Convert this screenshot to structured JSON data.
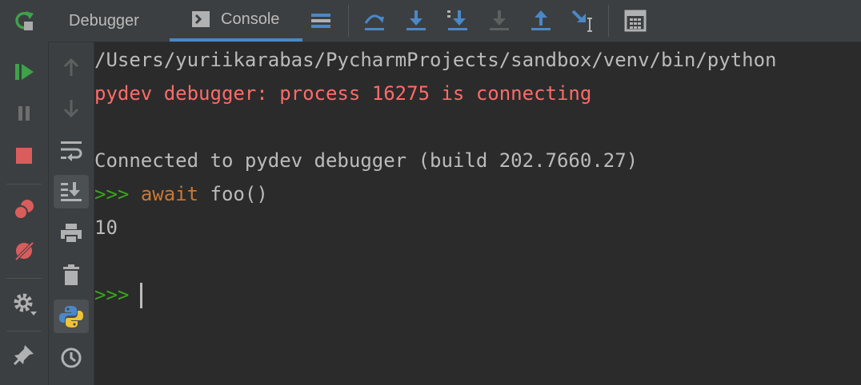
{
  "tabs": {
    "debugger": "Debugger",
    "console": "Console"
  },
  "console_lines": {
    "l1": "/Users/yuriikarabas/PycharmProjects/sandbox/venv/bin/python",
    "l2": "pydev debugger: process 16275 is connecting",
    "l3": "Connected to pydev debugger (build 202.7660.27)",
    "prompt": ">>>",
    "await_kw": "await",
    "call": "foo()",
    "output": "10",
    "prompt2": ">>>"
  },
  "icons": {
    "left": [
      "rerun-icon",
      "resume-icon",
      "pause-icon",
      "stop-icon",
      "view-breakpoints-icon",
      "mute-breakpoints-icon",
      "settings-icon",
      "pin-icon"
    ],
    "top": [
      "show-execution-point-icon",
      "step-over-icon",
      "step-into-icon",
      "step-into-my-code-icon",
      "force-step-into-icon",
      "step-out-icon",
      "run-to-cursor-icon",
      "evaluate-expression-icon"
    ],
    "console": [
      "up-arrow-icon",
      "down-arrow-icon",
      "soft-wrap-icon",
      "scroll-to-end-icon",
      "print-icon",
      "clear-all-icon",
      "python-console-icon",
      "history-icon"
    ]
  },
  "colors": {
    "accent": "#4a88c7",
    "error": "#ff6b68",
    "prompt": "#38a61c",
    "keyword": "#cc7832",
    "run": "#3fa14a",
    "stop": "#db5c5c"
  }
}
